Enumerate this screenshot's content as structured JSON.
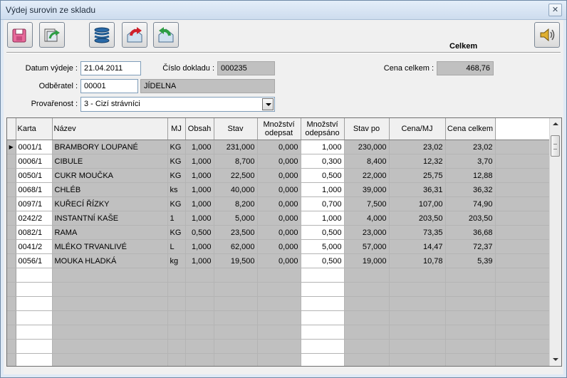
{
  "window": {
    "title": "Výdej surovin ze skladu",
    "close_label": "✕"
  },
  "toolbar": {
    "buttons": [
      "save-icon",
      "refresh-icon",
      "stack-icon",
      "return-red-icon",
      "return-green-icon"
    ],
    "sound_button": "speaker-icon"
  },
  "summary": {
    "heading": "Celkem",
    "total_label": "Cena celkem :",
    "total_value": "468,76"
  },
  "form": {
    "date_label": "Datum výdeje :",
    "date_value": "21.04.2011",
    "doc_label": "Číslo dokladu :",
    "doc_value": "000235",
    "customer_label": "Odběratel :",
    "customer_code": "00001",
    "customer_name": "JÍDELNA",
    "status_label": "Provařenost :",
    "status_value": "3 - Cizí strávníci"
  },
  "colors": {
    "readonly_gray": "#c0c0c0",
    "window_frame": "#dfe9f5",
    "grid_gray": "#c0c0c0"
  },
  "table": {
    "headers": [
      "Karta",
      "Název",
      "MJ",
      "Obsah",
      "Stav",
      "Množství odepsat",
      "Množství odepsáno",
      "Stav po",
      "Cena/MJ",
      "Cena celkem"
    ],
    "rows": [
      [
        "0001/1",
        "BRAMBORY LOUPANÉ",
        "KG",
        "1,000",
        "231,000",
        "0,000",
        "1,000",
        "230,000",
        "23,02",
        "23,02"
      ],
      [
        "0006/1",
        "CIBULE",
        "KG",
        "1,000",
        "8,700",
        "0,000",
        "0,300",
        "8,400",
        "12,32",
        "3,70"
      ],
      [
        "0050/1",
        "CUKR MOUČKA",
        "KG",
        "1,000",
        "22,500",
        "0,000",
        "0,500",
        "22,000",
        "25,75",
        "12,88"
      ],
      [
        "0068/1",
        "CHLÉB",
        "ks",
        "1,000",
        "40,000",
        "0,000",
        "1,000",
        "39,000",
        "36,31",
        "36,32"
      ],
      [
        "0097/1",
        "KUŘECÍ ŘÍZKY",
        "KG",
        "1,000",
        "8,200",
        "0,000",
        "0,700",
        "7,500",
        "107,00",
        "74,90"
      ],
      [
        "0242/2",
        "INSTANTNÍ KAŠE",
        "1",
        "1,000",
        "5,000",
        "0,000",
        "1,000",
        "4,000",
        "203,50",
        "203,50"
      ],
      [
        "0082/1",
        "RAMA",
        "KG",
        "0,500",
        "23,500",
        "0,000",
        "0,500",
        "23,000",
        "73,35",
        "36,68"
      ],
      [
        "0041/2",
        "MLÉKO TRVANLIVÉ",
        "L",
        "1,000",
        "62,000",
        "0,000",
        "5,000",
        "57,000",
        "14,47",
        "72,37"
      ],
      [
        "0056/1",
        "MOUKA HLADKÁ",
        "kg",
        "1,000",
        "19,500",
        "0,000",
        "0,500",
        "19,000",
        "10,78",
        "5,39"
      ]
    ],
    "current_row_marker": "▶",
    "empty_rows": 7
  }
}
